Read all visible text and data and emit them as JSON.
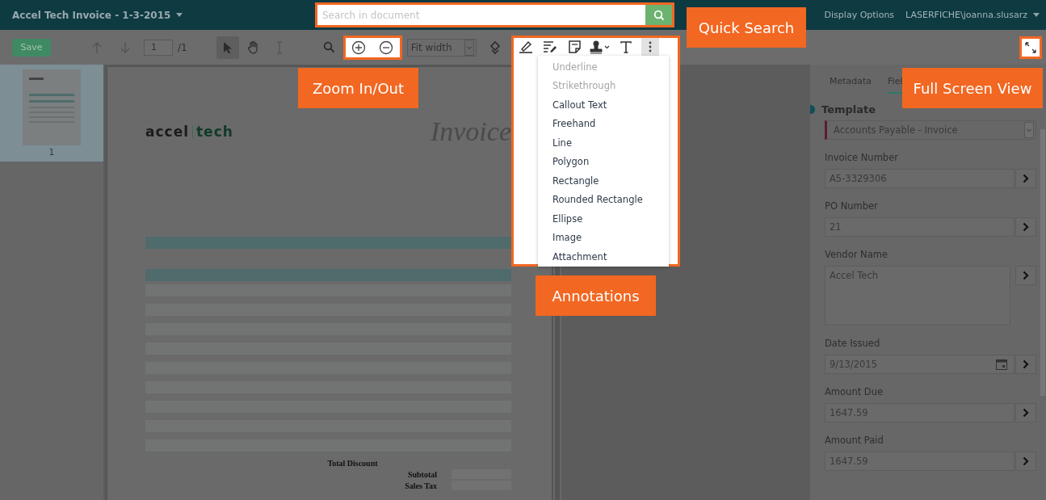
{
  "title_bar": {
    "title": "Accel Tech Invoice - 1-3-2015",
    "menu": [
      "Display Options"
    ],
    "user": "LASERFICHE\\joanna.slusarz"
  },
  "search": {
    "placeholder": "Search in document"
  },
  "toolbar": {
    "save": {
      "label": "Save",
      "disabled": true
    },
    "page": "1",
    "page_count": "/1",
    "zoom_mode": "Fit width",
    "tools": [
      {
        "kind": "pointer",
        "selected": true
      },
      {
        "kind": "hand",
        "selected": false
      },
      {
        "kind": "text",
        "selected": false
      }
    ]
  },
  "annotation_tools": [
    {
      "kind": "highlight",
      "selected": false
    },
    {
      "kind": "redact",
      "selected": false
    },
    {
      "kind": "note",
      "selected": false
    },
    {
      "kind": "stamp",
      "selected": false
    },
    {
      "kind": "text",
      "selected": false
    },
    {
      "kind": "more",
      "selected": true
    }
  ],
  "annotation_menu": [
    {
      "label": "Underline",
      "disabled": true
    },
    {
      "label": "Strikethrough",
      "disabled": true
    },
    {
      "label": "Callout Text",
      "disabled": false
    },
    {
      "label": "Freehand",
      "disabled": false
    },
    {
      "label": "Line",
      "disabled": false
    },
    {
      "label": "Polygon",
      "disabled": false
    },
    {
      "label": "Rectangle",
      "disabled": false
    },
    {
      "label": "Rounded Rectangle",
      "disabled": false
    },
    {
      "label": "Ellipse",
      "disabled": false
    },
    {
      "label": "Image",
      "disabled": false
    },
    {
      "label": "Attachment",
      "disabled": false
    }
  ],
  "thumbnails": [
    {
      "label": "1",
      "selected": true
    }
  ],
  "document": {
    "logo": [
      "accel",
      "tech"
    ],
    "heading": "Invoice",
    "totals": [
      "Total Discount",
      "Subtotal",
      "Sales Tax"
    ]
  },
  "panel": {
    "tabs": [
      {
        "label": "Metadata",
        "selected": false
      },
      {
        "label": "Fiel",
        "selected": true
      }
    ],
    "template": {
      "label": "Template",
      "value": "Accounts Payable - Invoice"
    },
    "fields": [
      {
        "label": "Invoice Number",
        "value": "A5-3329306",
        "kind": "text"
      },
      {
        "label": "PO Number",
        "value": "21",
        "kind": "text"
      },
      {
        "label": "Vendor Name",
        "value": "Accel Tech",
        "kind": "multiline"
      },
      {
        "label": "Date Issued",
        "value": "9/13/2015",
        "kind": "date"
      },
      {
        "label": "Amount Due",
        "value": "1647.59",
        "kind": "text"
      },
      {
        "label": "Amount Paid",
        "value": "1647.59",
        "kind": "text"
      }
    ]
  },
  "callouts": [
    {
      "text": "Quick Search",
      "kind": "search"
    },
    {
      "text": "Zoom In/Out",
      "kind": "zoom"
    },
    {
      "text": "Full Screen View",
      "kind": "fullscreen"
    },
    {
      "text": "Annotations",
      "kind": "annotations"
    }
  ]
}
